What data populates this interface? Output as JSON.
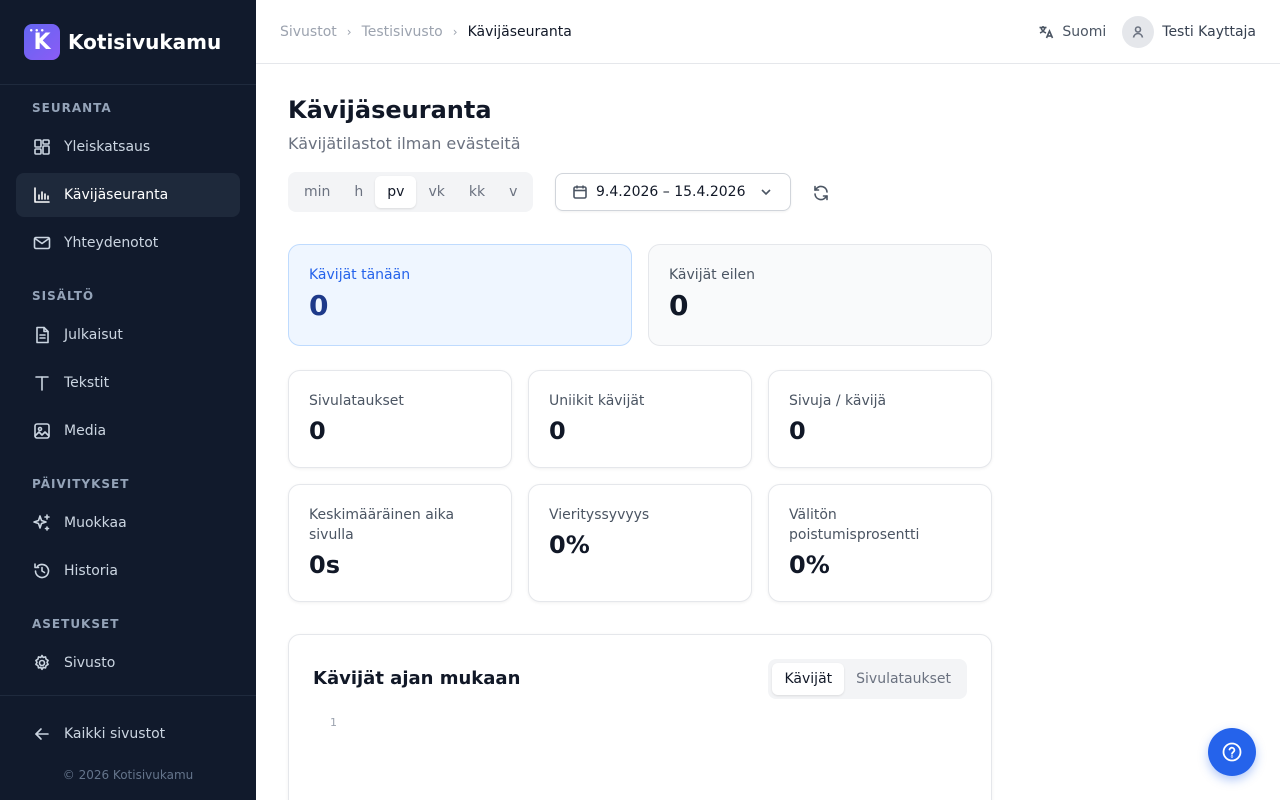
{
  "brand": {
    "name": "Kotisivukamu",
    "logo_letter": "K"
  },
  "sidebar": {
    "sections": [
      {
        "title": "SEURANTA"
      },
      {
        "title": "SISÄLTÖ"
      },
      {
        "title": "PÄIVITYKSET"
      },
      {
        "title": "ASETUKSET"
      }
    ],
    "items": [
      {
        "label": "Yleiskatsaus",
        "icon": "dashboard-grid-icon",
        "active": false
      },
      {
        "label": "Kävijäseuranta",
        "icon": "bar-chart-icon",
        "active": true
      },
      {
        "label": "Yhteydenotot",
        "icon": "mail-icon",
        "active": false
      },
      {
        "label": "Julkaisut",
        "icon": "document-icon",
        "active": false
      },
      {
        "label": "Tekstit",
        "icon": "text-icon",
        "active": false
      },
      {
        "label": "Media",
        "icon": "image-icon",
        "active": false
      },
      {
        "label": "Muokkaa",
        "icon": "sparkles-icon",
        "active": false
      },
      {
        "label": "Historia",
        "icon": "history-icon",
        "active": false
      },
      {
        "label": "Sivusto",
        "icon": "gear-icon",
        "active": false
      }
    ],
    "back_link": "Kaikki sivustot",
    "copyright": "© 2026 Kotisivukamu"
  },
  "topbar": {
    "breadcrumb": [
      "Sivustot",
      "Testisivusto",
      "Kävijäseuranta"
    ],
    "language": "Suomi",
    "user_name": "Testi Kayttaja"
  },
  "page": {
    "title": "Kävijäseuranta",
    "subtitle": "Kävijätilastot ilman evästeitä"
  },
  "controls": {
    "granularity": [
      "min",
      "h",
      "pv",
      "vk",
      "kk",
      "v"
    ],
    "granularity_selected": "pv",
    "date_range": "9.4.2026 – 15.4.2026"
  },
  "stats": {
    "today": {
      "label": "Kävijät tänään",
      "value": "0"
    },
    "yesterday": {
      "label": "Kävijät eilen",
      "value": "0"
    },
    "metrics": [
      {
        "label": "Sivulataukset",
        "value": "0"
      },
      {
        "label": "Uniikit kävijät",
        "value": "0"
      },
      {
        "label": "Sivuja / kävijä",
        "value": "0"
      },
      {
        "label": "Keskimääräinen aika sivulla",
        "value": "0s"
      },
      {
        "label": "Vierityssyvyys",
        "value": "0%"
      },
      {
        "label": "Välitön poistumisprosentti",
        "value": "0%"
      }
    ]
  },
  "chart": {
    "title": "Kävijät ajan mukaan",
    "tabs": [
      "Kävijät",
      "Sivulataukset"
    ],
    "selected_tab": "Kävijät"
  },
  "chart_data": {
    "type": "line",
    "title": "Kävijät ajan mukaan",
    "y_tick_labels": [
      "1"
    ],
    "series": []
  },
  "colors": {
    "sidebar_bg": "#111a2c",
    "accent": "#2563eb",
    "today_card_bg": "#eff6ff"
  }
}
